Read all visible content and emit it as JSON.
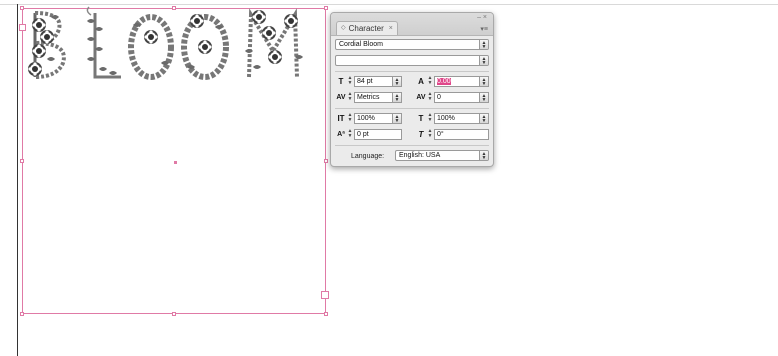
{
  "document": {
    "frame_text": "BLOOM",
    "frame_color": "#e07aa6"
  },
  "panel": {
    "tab_label": "Character",
    "tab_icon": "panel-icon",
    "close_glyph": "×",
    "window_controls": "– ×",
    "menu_glyph": "▾≡",
    "font_family": "Cordial Bloom",
    "font_style": "",
    "font_size": "84 pt",
    "leading": "0.00",
    "kerning": "Metrics",
    "tracking": "0",
    "vertical_scale": "100%",
    "horizontal_scale": "100%",
    "baseline_shift": "0 pt",
    "skew": "0°",
    "language_label": "Language:",
    "language_value": "English: USA",
    "highlight_color": "#e0478a"
  }
}
